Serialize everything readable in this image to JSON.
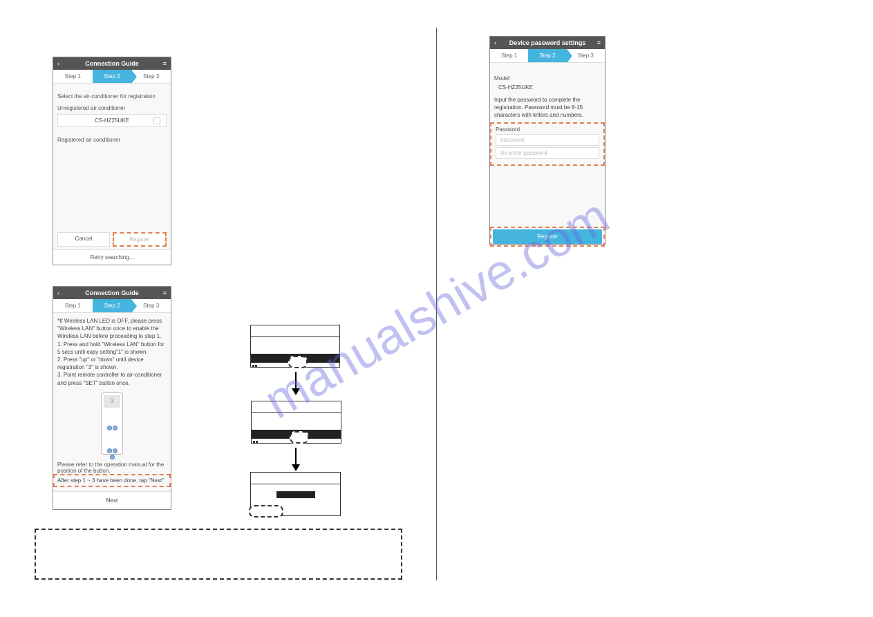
{
  "watermark": "manualshive.com",
  "phone1": {
    "title": "Connection Guide",
    "steps": [
      "Step 1",
      "Step 2",
      "Step 3"
    ],
    "select_label": "Select the air-conditioner for registration",
    "unregistered_label": "Unregistered air conditioner",
    "device_name": "CS-HZ25UKE",
    "registered_label": "Registered air conditioner",
    "cancel": "Cancel",
    "register": "Register",
    "retry": "Retry searching..."
  },
  "phone2": {
    "title": "Connection Guide",
    "steps": [
      "Step 1",
      "Step 2",
      "Step 3"
    ],
    "instructions_intro": "*If Wireless LAN LED is OFF, please press \"Wireless LAN\" button once to enable the Wireless LAN before proceeding to step 1.",
    "instructions_1": "1. Press and hold \"Wireless LAN\" button for 5 secs until easy setting\"1\" is shown.",
    "instructions_2": "2. Press \"up\" or \"down\" until device registration \"3\" is shown.",
    "instructions_3": "3. Point remote controller to air-conditioner and press \"SET\" button once.",
    "remote_display": "3",
    "note": "Please refer to the operation manual for the position of the button.",
    "after_step": "After step 1 ~ 3 have been done, tap \"Next\".",
    "next": "Next"
  },
  "phone3": {
    "title": "Device password settings",
    "steps": [
      "Step 1",
      "Step 2",
      "Step 3"
    ],
    "model_label": "Model:",
    "model_value": "CS-HZ25UKE",
    "instruction": "Input the password to complete the registration. Password must be 8-15 characters with letters and numbers.",
    "password_label": "Password",
    "password_placeholder": "password",
    "reenter_placeholder": "Re-enter password",
    "register": "Register"
  }
}
